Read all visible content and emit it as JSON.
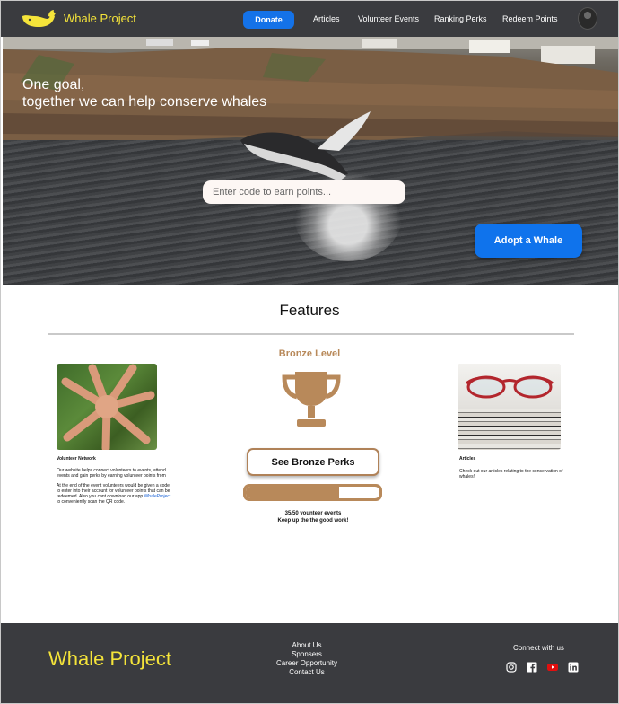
{
  "nav": {
    "brand": "Whale Project",
    "donate_label": "Donate",
    "links": [
      "Articles",
      "Volunteer Events",
      "Ranking Perks",
      "Redeem Points"
    ],
    "brand_color": "#f5e43a",
    "accent_color": "#1472e8"
  },
  "hero": {
    "title_line1": "One goal,",
    "title_line2": "together we can help conserve whales",
    "code_placeholder": "Enter code to earn points...",
    "adopt_label": "Adopt a Whale"
  },
  "features": {
    "title": "Features",
    "volunteer": {
      "heading": "Volunteer Network",
      "para1": "Our website helps connect volunteers to events, attend events and gain perks by earning volunteer points from",
      "para2_pre": "At the end of the event volunteers would be given a code to enter into their account for volunteer points that can be redeemed. Also you cant download our app ",
      "para2_link": "WhaleProject",
      "para2_post": " to conveniently scan the QR code."
    },
    "level": {
      "title": "Bronze Level",
      "perks_label": "See Bronze Perks",
      "progress_current": 35,
      "progress_total": 50,
      "progress_fraction": 0.7,
      "events_line": "35/50 vounteer events",
      "encourage_line": "Keep up the the good work!",
      "bronze_color": "#b8895a"
    },
    "articles": {
      "heading": "Articles",
      "text": "Check out our articles relating to the conservation of whales!"
    }
  },
  "footer": {
    "brand": "Whale Project",
    "links": [
      "About Us",
      "Sponsers",
      "Career Opportunity",
      "Contact Us"
    ],
    "connect_label": "Connect with us",
    "socials": [
      "instagram-icon",
      "facebook-icon",
      "youtube-icon",
      "linkedin-icon"
    ]
  }
}
